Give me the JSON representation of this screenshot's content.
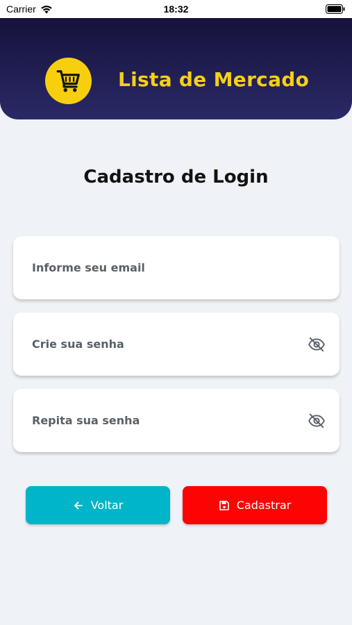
{
  "status_bar": {
    "carrier": "Carrier",
    "time": "18:32"
  },
  "header": {
    "app_title": "Lista de Mercado",
    "logo_icon": "shopping-cart-icon",
    "accent_color": "#f8cf0f",
    "background_color": "#1f1d50"
  },
  "page": {
    "title": "Cadastro de Login"
  },
  "form": {
    "email": {
      "placeholder": "Informe seu email",
      "value": ""
    },
    "password": {
      "placeholder": "Crie sua senha",
      "value": "",
      "toggle_icon": "eye-off-icon"
    },
    "confirm_password": {
      "placeholder": "Repita sua senha",
      "value": "",
      "toggle_icon": "eye-off-icon"
    }
  },
  "buttons": {
    "back": {
      "label": "Voltar",
      "icon": "arrow-left-icon",
      "color": "#01b5c8"
    },
    "register": {
      "label": "Cadastrar",
      "icon": "save-icon",
      "color": "#fd0303"
    }
  }
}
